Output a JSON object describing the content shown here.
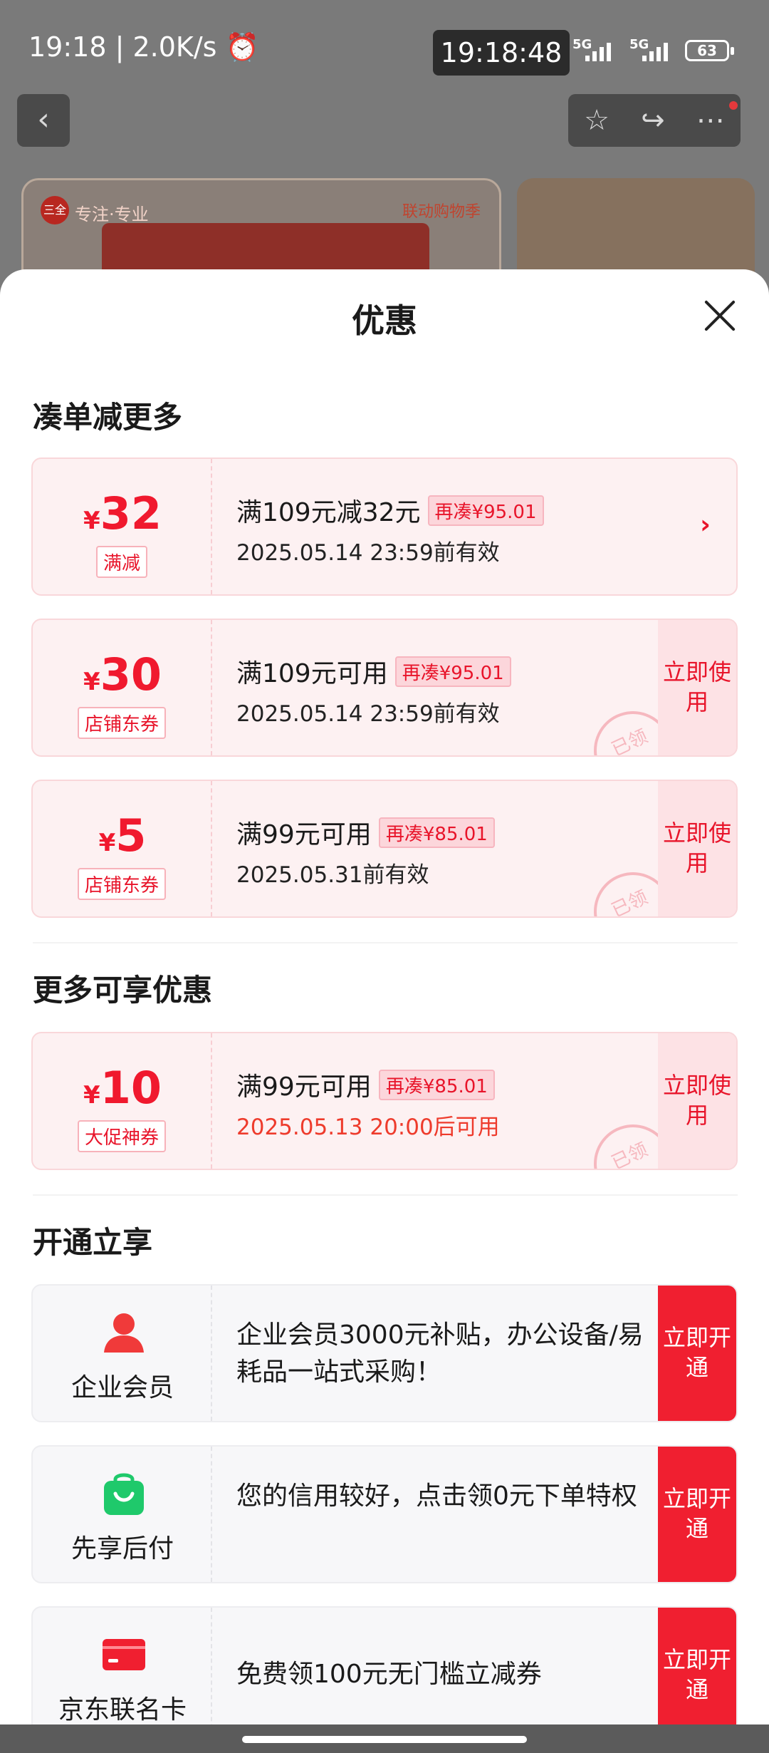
{
  "status_bar": {
    "left": "19:18 | 2.0K/s ⏰",
    "center_time": "19:18:48",
    "net1": "5G",
    "net2": "5G",
    "battery": "63"
  },
  "nav": {
    "back_icon": "‹",
    "star_icon": "☆",
    "share_icon": "↪",
    "more_icon": "⋯"
  },
  "product": {
    "brand": "专注·专业",
    "campaign": "联动购物季",
    "logo": "三全"
  },
  "sheet": {
    "title": "优惠"
  },
  "sections": {
    "s1": "凑单减更多",
    "s2": "更多可享优惠",
    "s3": "开通立享"
  },
  "coupons": [
    {
      "yen": "¥",
      "amount": "32",
      "tag": "满减",
      "title": "满109元减32元",
      "pill": "再凑¥95.01",
      "date": "2025.05.14 23:59前有效",
      "chevron": "›"
    },
    {
      "yen": "¥",
      "amount": "30",
      "tag": "店铺东券",
      "title": "满109元可用",
      "pill": "再凑¥95.01",
      "date": "2025.05.14 23:59前有效",
      "button": "立即使用",
      "stamp": "已领"
    },
    {
      "yen": "¥",
      "amount": "5",
      "tag": "店铺东券",
      "title": "满99元可用",
      "pill": "再凑¥85.01",
      "date": "2025.05.31前有效",
      "button": "立即使用",
      "stamp": "已领"
    },
    {
      "yen": "¥",
      "amount": "10",
      "tag": "大促神券",
      "title": "满99元可用",
      "pill": "再凑¥85.01",
      "date": "2025.05.13 20:00后可用",
      "button": "立即使用",
      "stamp": "已领"
    }
  ],
  "services": [
    {
      "name": "企业会员",
      "desc": " 企业会员3000元补贴，办公设备/易耗品一站式采购！",
      "button": "立即开通",
      "icon": "person-icon",
      "color": "#f03a3a"
    },
    {
      "name": "先享后付",
      "desc": "您的信用较好，点击领0元下单特权",
      "button": "立即开通",
      "icon": "shopping-bag-icon",
      "color": "#1fc96b"
    },
    {
      "name": "京东联名卡",
      "desc": "免费领100元无门槛立减券",
      "button": "立即开通",
      "icon": "card-icon",
      "color": "#f01f30"
    }
  ]
}
